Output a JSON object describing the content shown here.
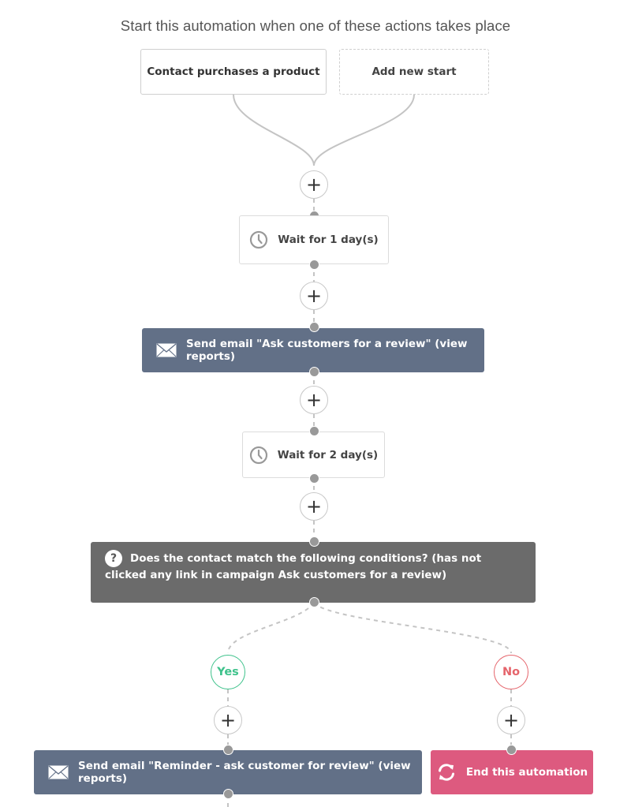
{
  "heading": "Start this automation when one of these actions takes place",
  "starts": [
    {
      "label": "Contact purchases a product",
      "style": "solid"
    },
    {
      "label": "Add new start",
      "style": "dashed"
    }
  ],
  "add_step_symbol": "+",
  "steps": [
    {
      "type": "wait",
      "icon": "clock-icon",
      "label": "Wait for 1 day(s)"
    },
    {
      "type": "email",
      "icon": "envelope-icon",
      "label": "Send email \"Ask customers for a review\" (view reports)"
    },
    {
      "type": "wait",
      "icon": "clock-icon",
      "label": "Wait for 2 day(s)"
    },
    {
      "type": "condition",
      "icon": "question-icon",
      "icon_glyph": "?",
      "label": "Does the contact match the following conditions? (has not clicked any link in campaign Ask customers for a review)"
    }
  ],
  "branches": {
    "yes": {
      "label": "Yes",
      "color": "#3ec28b",
      "action": {
        "type": "email",
        "icon": "envelope-icon",
        "label": "Send email \"Reminder - ask customer for review\" (view reports)"
      }
    },
    "no": {
      "label": "No",
      "color": "#e5646b",
      "action": {
        "type": "end",
        "icon": "refresh-icon",
        "label": "End this automation"
      }
    }
  },
  "colors": {
    "email_block": "#627087",
    "condition_block": "#6b6b6b",
    "end_block": "#dd5a7f",
    "connector": "#c4c4c4",
    "node_dot": "#999999"
  }
}
